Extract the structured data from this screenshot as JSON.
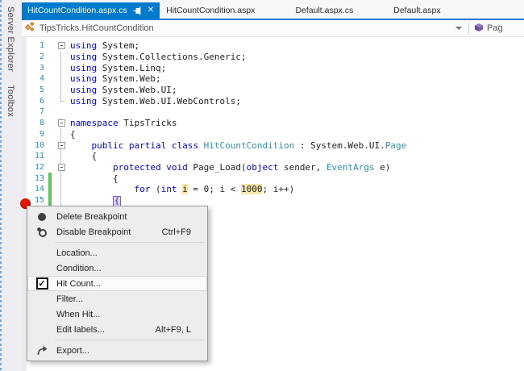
{
  "sidebar": {
    "tabs": [
      {
        "label": "Server Explorer"
      },
      {
        "label": "Toolbox"
      }
    ]
  },
  "tab_strip": {
    "tabs": [
      {
        "label": "HitCountCondition.aspx.cs",
        "active": true,
        "close_glyph": "✕"
      },
      {
        "label": "HitCountCondition.aspx",
        "active": false
      },
      {
        "label": "Default.aspx.cs",
        "active": false
      },
      {
        "label": "Default.aspx",
        "active": false
      }
    ]
  },
  "navigation_bar": {
    "type_selector": {
      "label": "TipsTricks.HitCountCondition"
    },
    "member_selector": {
      "label": "Pag"
    }
  },
  "editor": {
    "lines": [
      {
        "num": "1",
        "fold": "box",
        "segments": [
          {
            "c": "kw",
            "t": "using"
          },
          {
            "c": "pl",
            "t": " System;"
          }
        ]
      },
      {
        "num": "2",
        "fold": "line",
        "segments": [
          {
            "c": "kw",
            "t": "using"
          },
          {
            "c": "pl",
            "t": " System.Collections.Generic;"
          }
        ]
      },
      {
        "num": "3",
        "fold": "line",
        "segments": [
          {
            "c": "kw",
            "t": "using"
          },
          {
            "c": "pl",
            "t": " System.Linq;"
          }
        ]
      },
      {
        "num": "4",
        "fold": "line",
        "segments": [
          {
            "c": "kw",
            "t": "using"
          },
          {
            "c": "pl",
            "t": " System.Web;"
          }
        ]
      },
      {
        "num": "5",
        "fold": "line",
        "segments": [
          {
            "c": "kw",
            "t": "using"
          },
          {
            "c": "pl",
            "t": " System.Web.UI;"
          }
        ]
      },
      {
        "num": "6",
        "fold": "end",
        "segments": [
          {
            "c": "kw",
            "t": "using"
          },
          {
            "c": "pl",
            "t": " System.Web.UI.WebControls;"
          }
        ]
      },
      {
        "num": "7",
        "fold": "",
        "segments": []
      },
      {
        "num": "8",
        "fold": "box",
        "segments": [
          {
            "c": "kw",
            "t": "namespace"
          },
          {
            "c": "pl",
            "t": " TipsTricks"
          }
        ]
      },
      {
        "num": "9",
        "fold": "line",
        "segments": [
          {
            "c": "pl",
            "t": "{"
          }
        ]
      },
      {
        "num": "10",
        "fold": "box",
        "segments": [
          {
            "c": "pl",
            "t": "    "
          },
          {
            "c": "kw",
            "t": "public"
          },
          {
            "c": "pl",
            "t": " "
          },
          {
            "c": "kw",
            "t": "partial"
          },
          {
            "c": "pl",
            "t": " "
          },
          {
            "c": "kw",
            "t": "class"
          },
          {
            "c": "pl",
            "t": " "
          },
          {
            "c": "ty",
            "t": "HitCountCondition"
          },
          {
            "c": "pl",
            "t": " : System.Web.UI."
          },
          {
            "c": "ty",
            "t": "Page"
          }
        ]
      },
      {
        "num": "11",
        "fold": "line",
        "segments": [
          {
            "c": "pl",
            "t": "    {"
          }
        ]
      },
      {
        "num": "12",
        "fold": "box",
        "segments": [
          {
            "c": "pl",
            "t": "        "
          },
          {
            "c": "kw",
            "t": "protected"
          },
          {
            "c": "pl",
            "t": " "
          },
          {
            "c": "kw",
            "t": "void"
          },
          {
            "c": "pl",
            "t": " Page_Load("
          },
          {
            "c": "kw",
            "t": "object"
          },
          {
            "c": "pl",
            "t": " sender, "
          },
          {
            "c": "ty",
            "t": "EventArgs"
          },
          {
            "c": "pl",
            "t": " e)"
          }
        ]
      },
      {
        "num": "13",
        "fold": "line",
        "chg": true,
        "segments": [
          {
            "c": "pl",
            "t": "        {"
          }
        ]
      },
      {
        "num": "14",
        "fold": "line",
        "chg": true,
        "segments": [
          {
            "c": "pl",
            "t": "            "
          },
          {
            "c": "kw",
            "t": "for"
          },
          {
            "c": "pl",
            "t": " ("
          },
          {
            "c": "kw",
            "t": "int"
          },
          {
            "c": "pl",
            "t": " "
          },
          {
            "c": "hi",
            "t": "i"
          },
          {
            "c": "pl",
            "t": " = 0; i < "
          },
          {
            "c": "hi",
            "t": "1000"
          },
          {
            "c": "pl",
            "t": "; i++)"
          }
        ]
      },
      {
        "num": "15",
        "fold": "line",
        "chg": true,
        "segments": [
          {
            "c": "pl",
            "t": "        "
          },
          {
            "c": "box",
            "t": "{"
          }
        ]
      }
    ],
    "breakpoint_line": "15"
  },
  "context_menu": {
    "items": [
      {
        "icon": "breakpoint-icon",
        "label": "Delete Breakpoint"
      },
      {
        "icon": "breakpoint-disabled-icon",
        "label": "Disable Breakpoint",
        "shortcut": "Ctrl+F9"
      },
      {
        "type": "separator"
      },
      {
        "label": "Location..."
      },
      {
        "label": "Condition..."
      },
      {
        "icon": "checkbox-checked-icon",
        "check_glyph": "✓",
        "label": "Hit Count...",
        "highlighted": true
      },
      {
        "label": "Filter..."
      },
      {
        "label": "When Hit..."
      },
      {
        "label": "Edit labels...",
        "shortcut": "Alt+F9, L"
      },
      {
        "type": "separator"
      },
      {
        "icon": "export-icon",
        "label": "Export..."
      }
    ]
  },
  "colors": {
    "accent_blue": "#007ACC",
    "keyword": "#0000FF",
    "type_name": "#2B91AF",
    "line_number": "#2B91AF",
    "reference_highlight": "#F5E6A9",
    "change_bar_green": "#5BC75B",
    "breakpoint_red": "#E41400"
  }
}
